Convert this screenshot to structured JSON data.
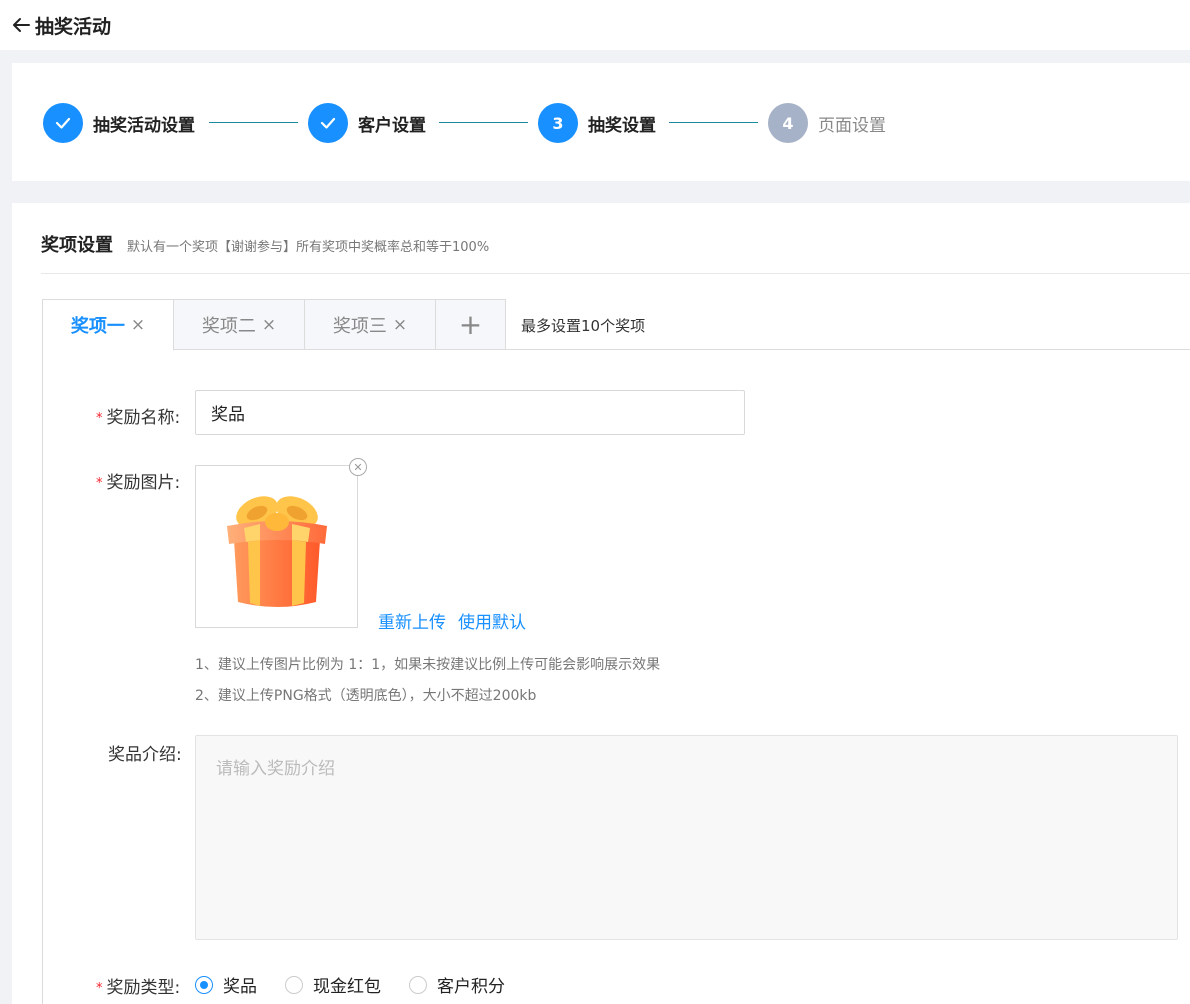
{
  "header": {
    "title": "抽奖活动"
  },
  "steps": [
    {
      "label": "抽奖活动设置",
      "status": "done",
      "number": ""
    },
    {
      "label": "客户设置",
      "status": "done",
      "number": ""
    },
    {
      "label": "抽奖设置",
      "status": "active",
      "number": "3"
    },
    {
      "label": "页面设置",
      "status": "todo",
      "number": "4"
    }
  ],
  "section": {
    "title": "奖项设置",
    "description": "默认有一个奖项【谢谢参与】所有奖项中奖概率总和等于100%"
  },
  "tabs": {
    "items": [
      {
        "label": "奖项一",
        "active": true
      },
      {
        "label": "奖项二",
        "active": false
      },
      {
        "label": "奖项三",
        "active": false
      }
    ],
    "close_glyph": "×",
    "add_glyph": "+",
    "note": "最多设置10个奖项"
  },
  "form": {
    "name": {
      "label": "奖励名称:",
      "value": "奖品"
    },
    "image": {
      "label": "奖励图片:",
      "reupload": "重新上传",
      "use_default": "使用默认",
      "hints": [
        "1、建议上传图片比例为 1：1，如果未按建议比例上传可能会影响展示效果",
        "2、建议上传PNG格式（透明底色），大小不超过200kb"
      ]
    },
    "intro": {
      "label": "奖品介绍:",
      "placeholder": "请输入奖励介绍"
    },
    "type": {
      "label": "奖励类型:",
      "options": [
        {
          "label": "奖品",
          "checked": true
        },
        {
          "label": "现金红包",
          "checked": false
        },
        {
          "label": "客户积分",
          "checked": false
        }
      ]
    }
  },
  "colors": {
    "primary": "#1890ff",
    "required": "#f5222d",
    "step_todo": "#a6b2c8"
  }
}
